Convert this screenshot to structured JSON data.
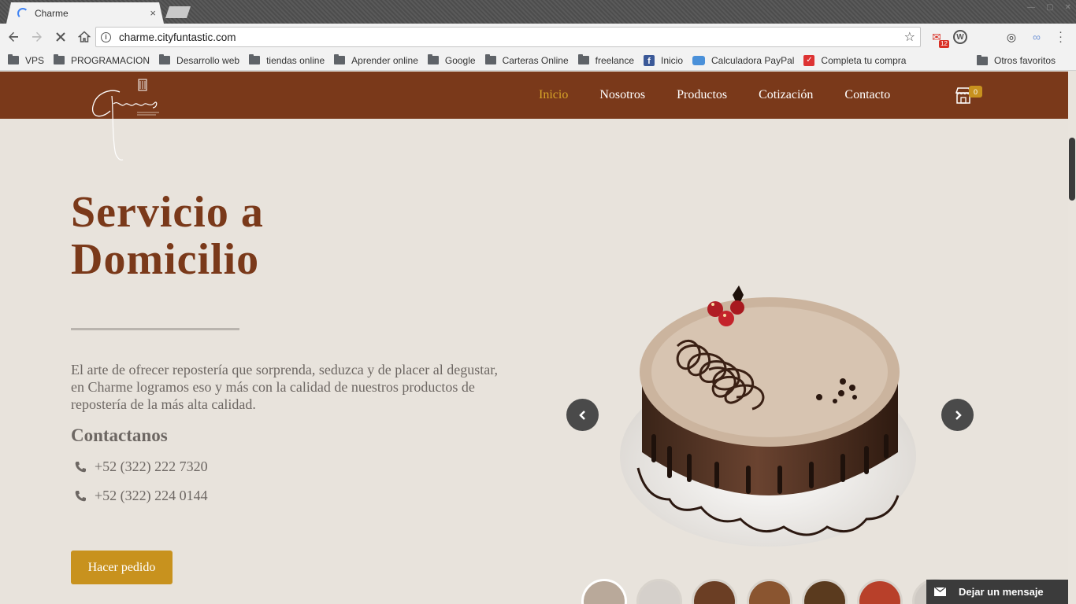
{
  "browser": {
    "tab_title": "Charme",
    "tab_close": "×",
    "url": "charme.cityfuntastic.com",
    "star": "☆",
    "gmail_badge": "12",
    "bookmarks": [
      {
        "label": "VPS",
        "icon": "folder-icon"
      },
      {
        "label": "PROGRAMACION",
        "icon": "folder-icon"
      },
      {
        "label": "Desarrollo web",
        "icon": "folder-icon"
      },
      {
        "label": "tiendas online",
        "icon": "folder-icon"
      },
      {
        "label": "Aprender online",
        "icon": "folder-icon"
      },
      {
        "label": "Google",
        "icon": "folder-icon"
      },
      {
        "label": "Carteras Online",
        "icon": "folder-icon"
      },
      {
        "label": "freelance",
        "icon": "folder-icon"
      },
      {
        "label": "Inicio",
        "icon": "facebook-icon"
      },
      {
        "label": "Calculadora PayPal",
        "icon": "paypal-icon"
      },
      {
        "label": "Completa tu compra",
        "icon": "todo-icon"
      }
    ],
    "bookmarks_more": "»",
    "other_bookmarks": "Otros favoritos"
  },
  "site": {
    "nav": [
      "Inicio",
      "Nosotros",
      "Productos",
      "Cotización",
      "Contacto"
    ],
    "active_nav": "Inicio",
    "cart_count": "0",
    "colors": {
      "header": "#7a391a",
      "accent": "#d7a428",
      "button": "#c8921e"
    }
  },
  "hero": {
    "title_line1": "Servicio a",
    "title_line2": "Domicilio",
    "text": "El arte de ofrecer repostería que sorprenda, seduzca y de placer al degustar, en Charme logramos eso y más con la calidad de nuestros productos de repostería de la más alta calidad.",
    "contact_title": "Contactanos",
    "phones": [
      "+52 (322) 222 7320",
      "+52 (322) 224 0144"
    ],
    "order_button": "Hacer pedido"
  },
  "carousel": {
    "thumb_count": 7,
    "active_index": 0
  },
  "chat": {
    "label": "Dejar un mensaje"
  }
}
